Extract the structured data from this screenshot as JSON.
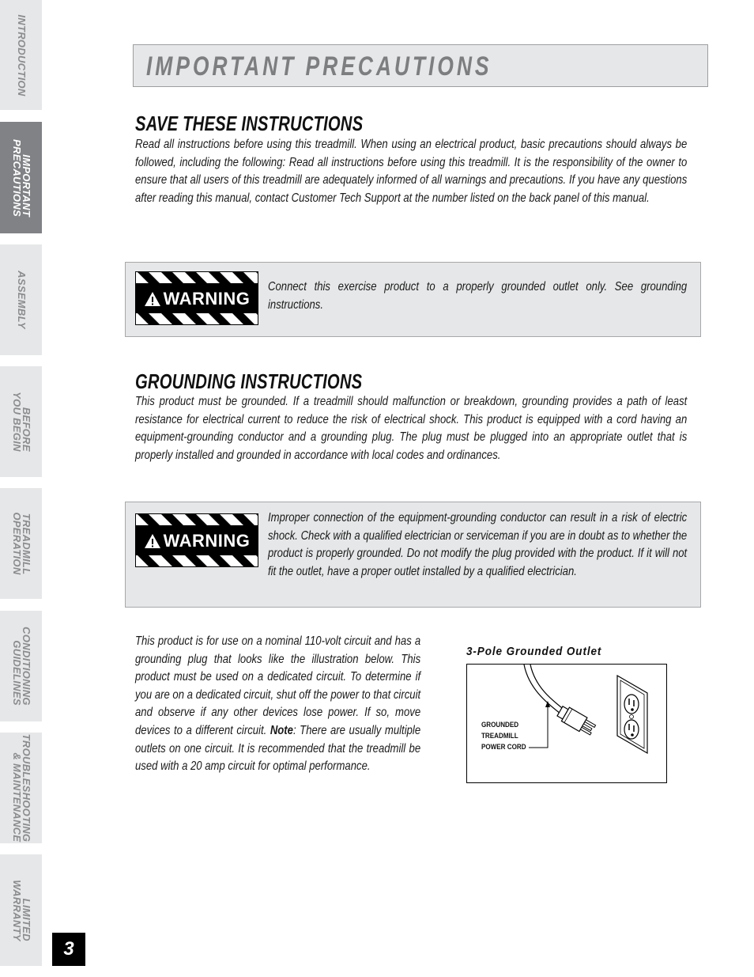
{
  "sidebar": {
    "tabs": [
      {
        "label": "INTRODUCTION",
        "active": false
      },
      {
        "label": "IMPORTANT\nPRECAUTIONS",
        "active": true
      },
      {
        "label": "ASSEMBLY",
        "active": false
      },
      {
        "label": "BEFORE\nYOU BEGIN",
        "active": false
      },
      {
        "label": "TREADMILL\nOPERATION",
        "active": false
      },
      {
        "label": "CONDITIONING\nGUIDELINES",
        "active": false
      },
      {
        "label": "TROUBLESHOOTING\n& MAINTENANCE",
        "active": false
      },
      {
        "label": "LIMITED\nWARRANTY",
        "active": false
      }
    ]
  },
  "page_number": "3",
  "header": {
    "title": "IMPORTANT PRECAUTIONS"
  },
  "save_section": {
    "heading": "SAVE THESE INSTRUCTIONS",
    "body": "Read all instructions before using this treadmill. When using an electrical product, basic precautions should always be followed, including the following: Read all instructions before using this treadmill. It is the responsibility of the owner to ensure that all users of this treadmill are adequately informed of all warnings and precautions. If you have any questions after reading this manual, contact Customer Tech Support at the number listed on the back panel of this manual."
  },
  "warnings": [
    {
      "badge": "WARNING",
      "text": "Connect this exercise product to a properly grounded outlet only. See grounding instructions."
    },
    {
      "badge": "WARNING",
      "text": "Improper connection of the equipment-grounding conductor can result in a risk of electric shock. Check with a qualified electrician or serviceman if you are in doubt as to whether the product is properly grounded. Do not modify the plug provided with the product. If it will not fit the outlet, have a proper outlet installed by a qualified electrician."
    }
  ],
  "grounding_section": {
    "heading": "GROUNDING INSTRUCTIONS",
    "body": "This product must be grounded. If a treadmill should malfunction or breakdown, grounding provides a path of least resistance for electrical current to reduce the risk of electrical shock. This product is equipped with a cord having an equipment-grounding conductor and a grounding plug. The plug must be plugged into an appropriate outlet that is properly installed and grounded in accordance with local codes and ordinances."
  },
  "circuit_section": {
    "body_before_note": "This product is for use on a nominal 110-volt circuit and has a grounding plug that looks like the  illustration below. This product must be used on a dedicated circuit. To determine if you are on a dedicated circuit, shut off the power to that circuit and observe if any other devices lose power. If so, move devices to a different circuit. ",
    "note_label": "Note",
    "body_after_note": ": There are usually multiple outlets on one circuit. It is recommended that the treadmill be used with a 20 amp circuit for optimal performance."
  },
  "figure": {
    "caption": "3-Pole Grounded Outlet",
    "label_lines": [
      "GROUNDED",
      "TREADMILL",
      "POWER CORD"
    ],
    "icons": [
      "power-cord-plug-illustration",
      "duplex-outlet-illustration"
    ]
  }
}
